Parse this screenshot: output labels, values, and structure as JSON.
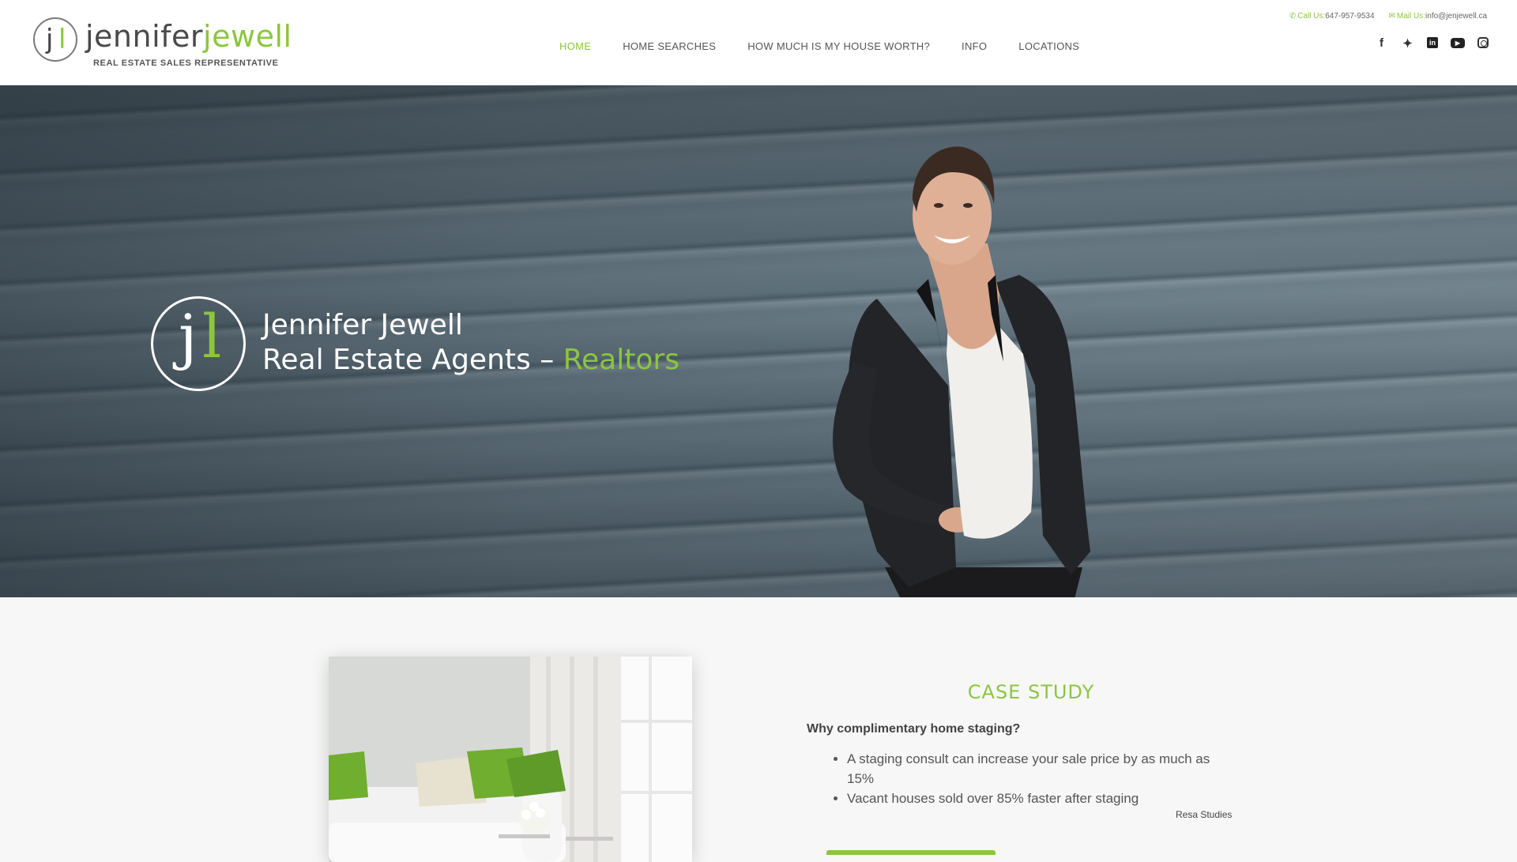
{
  "brand": {
    "mark_j": "j",
    "mark_l": "l",
    "name_first": "jennifer",
    "name_last": "jewell",
    "subtitle": "REAL ESTATE SALES REPRESENTATIVE"
  },
  "nav": {
    "items": [
      {
        "label": "HOME",
        "active": true
      },
      {
        "label": "HOME SEARCHES",
        "active": false
      },
      {
        "label": "HOW MUCH IS MY HOUSE WORTH?",
        "active": false
      },
      {
        "label": "INFO",
        "active": false
      },
      {
        "label": "LOCATIONS",
        "active": false
      }
    ]
  },
  "contact": {
    "call_label": "Call Us:",
    "call_value": "647-957-9534",
    "mail_label": "Mail Us:",
    "mail_value": "info@jenjewell.ca"
  },
  "social": {
    "icons": [
      "facebook-icon",
      "twitter-icon",
      "linkedin-icon",
      "youtube-icon",
      "instagram-icon"
    ]
  },
  "hero": {
    "line1": "Jennifer Jewell",
    "line2_prefix": "Real Estate Agents – ",
    "line2_highlight": "Realtors"
  },
  "case_study": {
    "title": "CASE STUDY",
    "question": "Why complimentary home staging?",
    "bullets": [
      "A staging consult can increase your sale price by as much as 15%",
      "Vacant houses sold over 85% faster after staging"
    ],
    "source": "Resa Studies"
  },
  "colors": {
    "accent": "#8cc63f",
    "text": "#555555",
    "header_bg": "#ffffff",
    "section_bg": "#f7f7f7"
  }
}
